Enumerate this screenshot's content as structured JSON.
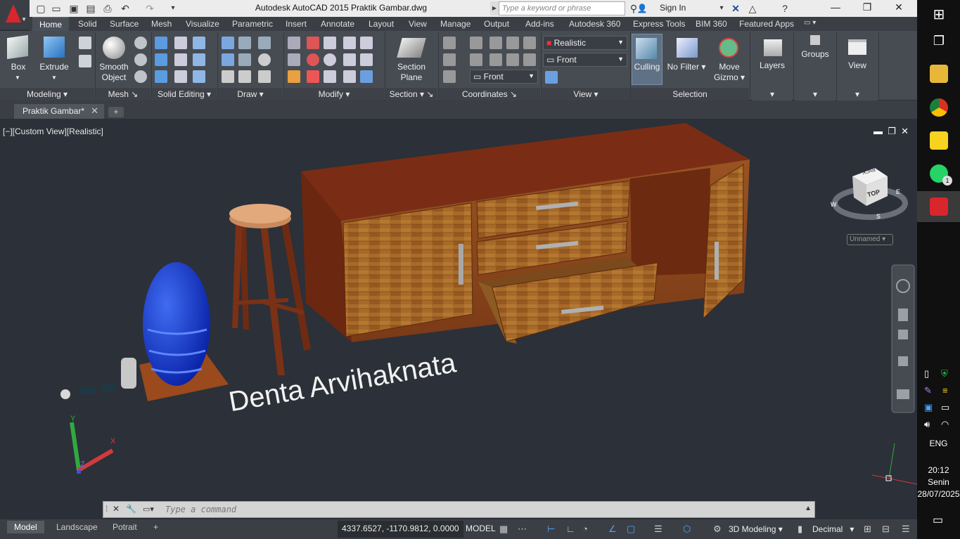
{
  "titlebar": {
    "title": "Autodesk AutoCAD 2015    Praktik Gambar.dwg",
    "search_placeholder": "Type a keyword or phrase",
    "sign_in": "Sign In"
  },
  "ribbon_tabs": [
    "Home",
    "Solid",
    "Surface",
    "Mesh",
    "Visualize",
    "Parametric",
    "Insert",
    "Annotate",
    "Layout",
    "View",
    "Manage",
    "Output",
    "Add-ins",
    "Autodesk 360",
    "Express Tools",
    "BIM 360",
    "Featured Apps"
  ],
  "ribbon": {
    "box": "Box",
    "extrude": "Extrude",
    "smooth_object_1": "Smooth",
    "smooth_object_2": "Object",
    "section_plane_1": "Section",
    "section_plane_2": "Plane",
    "visual_style": "Realistic",
    "view_front": "Front",
    "ucs_front": "Front",
    "culling": "Culling",
    "no_filter": "No Filter",
    "move_gizmo_1": "Move",
    "move_gizmo_2": "Gizmo",
    "layers": "Layers",
    "groups": "Groups",
    "view": "View",
    "panels": {
      "modeling": "Modeling",
      "mesh": "Mesh",
      "solid_editing": "Solid Editing",
      "draw": "Draw",
      "modify": "Modify",
      "section": "Section",
      "coordinates": "Coordinates",
      "view": "View",
      "selection": "Selection"
    }
  },
  "document_tab": "Praktik Gambar*",
  "viewport": {
    "label": "[−][Custom View][Realistic]",
    "scene_text": "Denta Arvihaknata",
    "viewcube_top": "TOP",
    "viewcube_back": "BACK",
    "compass": {
      "n": "",
      "s": "S",
      "e": "E",
      "w": "W"
    },
    "ucs_name": "Unnamed",
    "ucs_axes": {
      "x": "X",
      "y": "Y",
      "z": "Z"
    }
  },
  "command_line": {
    "placeholder": "Type a command"
  },
  "statusbar": {
    "layouts": [
      "Model",
      "Landscape",
      "Potrait"
    ],
    "coordinates": "4337.6527, -1170.9812, 0.0000",
    "model": "MODEL",
    "workspace": "3D Modeling",
    "units": "Decimal"
  },
  "taskbar": {
    "lang": "ENG",
    "time": "20:12",
    "day": "Senin",
    "date": "28/07/2025",
    "whatsapp_badge": "1"
  }
}
